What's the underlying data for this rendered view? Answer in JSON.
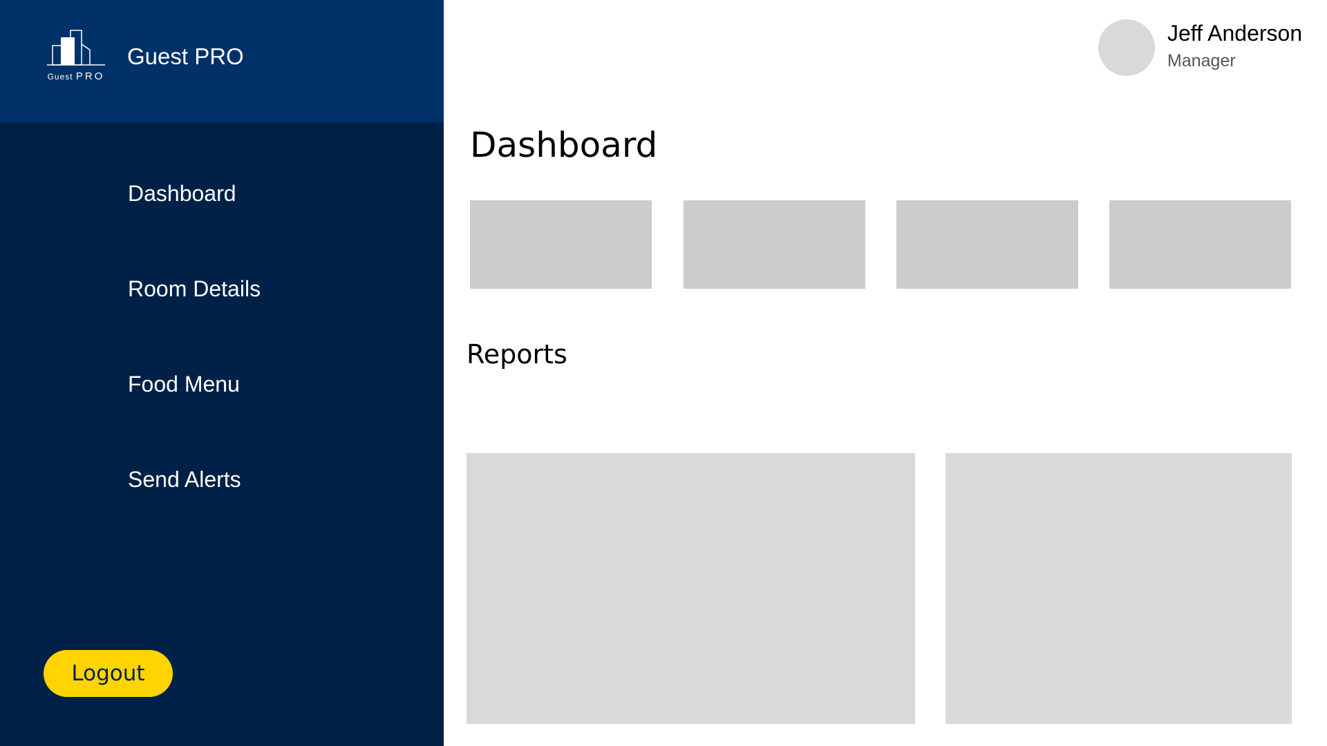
{
  "brand": {
    "name": "Guest PRO",
    "logo_caption_small": "Guest",
    "logo_caption_big": "PRO"
  },
  "sidebar": {
    "items": [
      {
        "label": "Dashboard"
      },
      {
        "label": "Room Details"
      },
      {
        "label": "Food Menu"
      },
      {
        "label": "Send Alerts"
      }
    ],
    "logout_label": "Logout"
  },
  "user": {
    "name": "Jeff Anderson",
    "role": "Manager"
  },
  "main": {
    "title": "Dashboard",
    "reports_title": "Reports"
  },
  "colors": {
    "sidebar_bg": "#002147",
    "brand_bg": "#003169",
    "logout_bg": "#ffd400",
    "placeholder_card": "#cccccc",
    "placeholder_panel": "#d9d9d9"
  }
}
